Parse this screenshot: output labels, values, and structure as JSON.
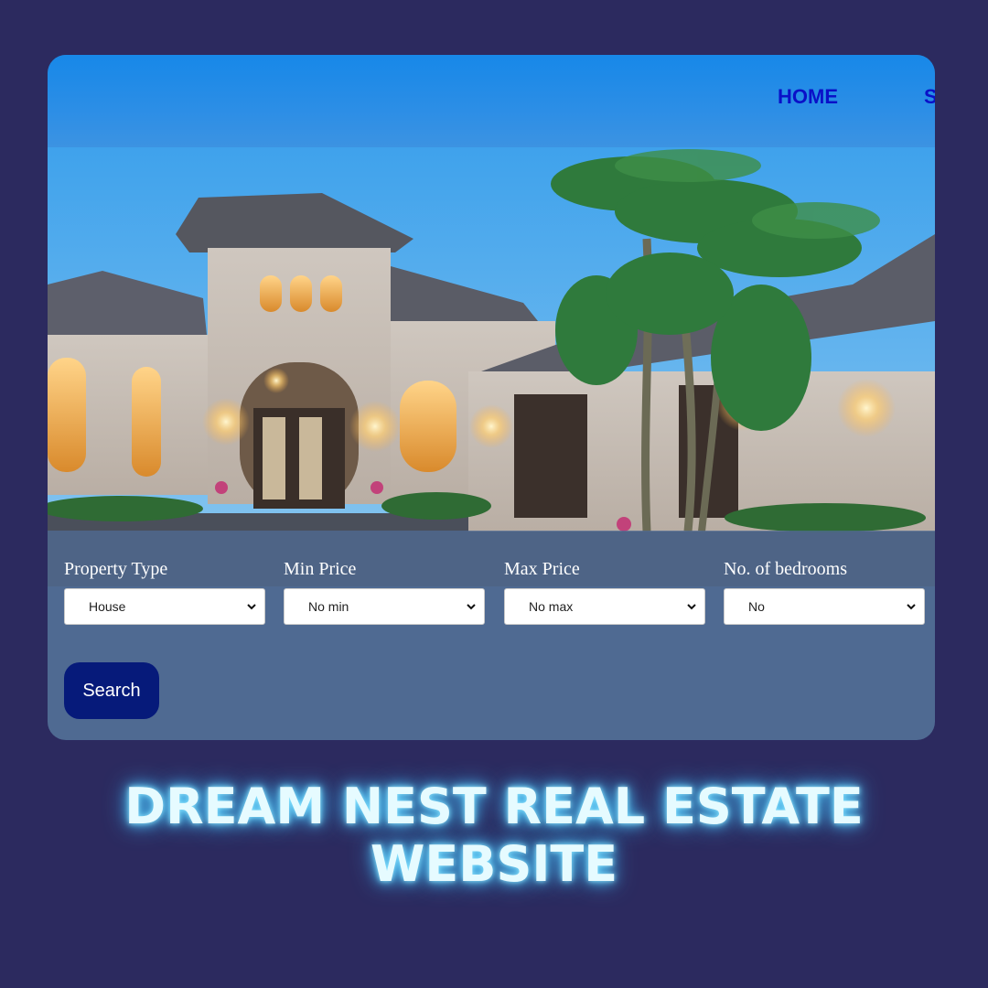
{
  "nav": {
    "items": [
      {
        "label": "HOME"
      },
      {
        "label": "S"
      }
    ]
  },
  "hero": {
    "image_semantic": "luxury-house-at-dusk-photo"
  },
  "search_form": {
    "fields": [
      {
        "label": "Property Type",
        "value": "House"
      },
      {
        "label": "Min Price",
        "value": "No min"
      },
      {
        "label": "Max Price",
        "value": "No max"
      },
      {
        "label": "No. of bedrooms",
        "value": "No"
      }
    ],
    "submit_label": "Search"
  },
  "headline": "DREAM NEST REAL ESTATE WEBSITE",
  "colors": {
    "page_background": "#2c2a5f",
    "navbar": "#1f8be8",
    "nav_text": "#0a10c8",
    "search_button": "#061a7a",
    "headline_glow": "#56cfff"
  }
}
